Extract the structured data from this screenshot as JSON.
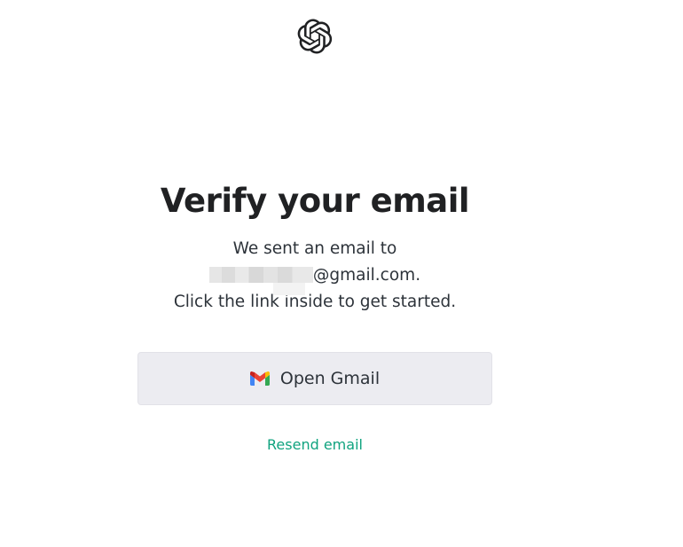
{
  "logo": {
    "icon": "openai-logo-icon"
  },
  "heading": "Verify your email",
  "message": {
    "line1": "We sent an email to",
    "email_suffix": "@gmail.com.",
    "line3": "Click the link inside to get started."
  },
  "open_gmail": {
    "label": "Open Gmail",
    "icon": "gmail-icon"
  },
  "resend": {
    "label": "Resend email"
  },
  "colors": {
    "accent": "#10a37f",
    "text": "#202123",
    "button_bg": "#ececf1"
  }
}
